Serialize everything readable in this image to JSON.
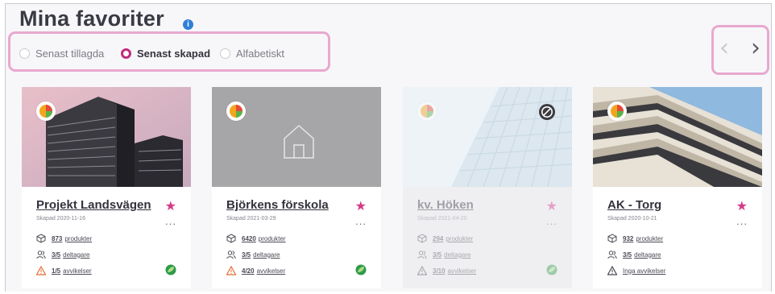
{
  "header": {
    "title": "Mina favoriter",
    "info_icon": "i"
  },
  "sort": {
    "options": [
      {
        "label": "Senast tillagda",
        "selected": false
      },
      {
        "label": "Senast skapad",
        "selected": true
      },
      {
        "label": "Alfabetiskt",
        "selected": false
      }
    ]
  },
  "nav": {
    "prev": "‹",
    "next": "›"
  },
  "colors": {
    "accent": "#d43a88",
    "highlight_border": "#e8a8cf",
    "info": "#2f7fd6",
    "warning": "#e46f3a"
  },
  "cards": [
    {
      "title": "Projekt Landsvägen",
      "date": "Skapad 2020-11-16",
      "products_num": "873",
      "products_label": "produkter",
      "participants_num": "3/5",
      "participants_label": "deltagare",
      "deviations_num": "1/5",
      "deviations_label": "avvikelser",
      "more": "...",
      "star": "★"
    },
    {
      "title": "Björkens förskola",
      "date": "Skapad 2021-03-29",
      "products_num": "6420",
      "products_label": "produkter",
      "participants_num": "3/5",
      "participants_label": "deltagare",
      "deviations_num": "4/20",
      "deviations_label": "avvikelser",
      "more": "...",
      "star": "★"
    },
    {
      "title": "kv. Höken",
      "date": "Skapad 2021-04-20",
      "products_num": "294",
      "products_label": "produkter",
      "participants_num": "3/5",
      "participants_label": "deltagare",
      "deviations_num": "3/10",
      "deviations_label": "avvikelser",
      "more": "...",
      "star": "★"
    },
    {
      "title": "AK - Torg",
      "date": "Skapad 2020-10-21",
      "products_num": "932",
      "products_label": "produkter",
      "participants_num": "3/5",
      "participants_label": "deltagare",
      "deviations_text": "Inga avvikelser",
      "more": "...",
      "star": "★"
    }
  ]
}
